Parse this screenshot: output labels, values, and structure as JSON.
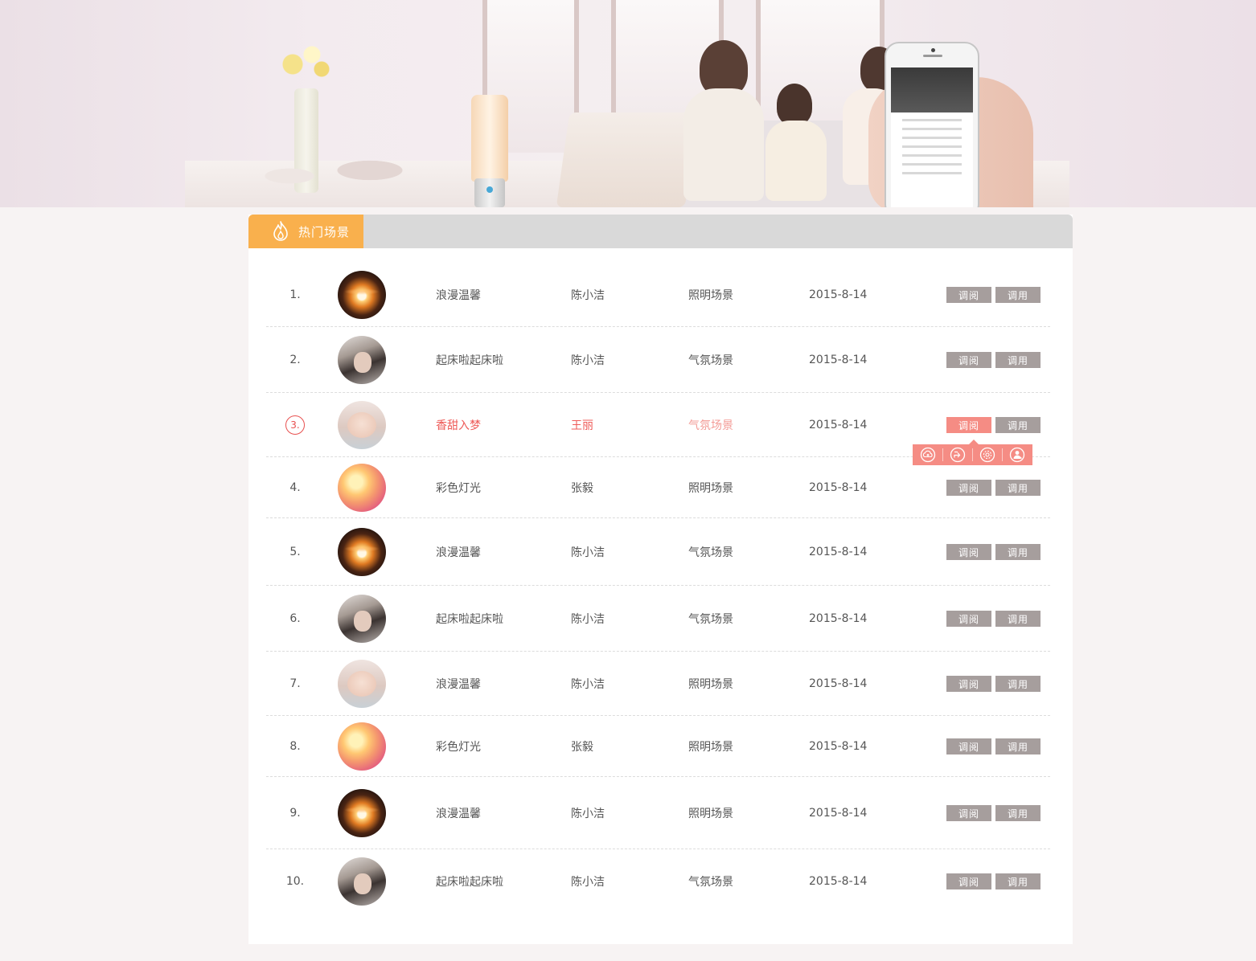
{
  "panel": {
    "title": "热门场景",
    "flame_icon": "flame-icon"
  },
  "colors": {
    "accent_orange": "#f9b04d",
    "highlight_red": "#ee5b58",
    "button_gray": "#a69e9d",
    "button_active": "#f58c84"
  },
  "buttons": {
    "view": "调阅",
    "apply": "调用"
  },
  "popup": {
    "icons": [
      "cloud-upload-icon",
      "share-icon",
      "settings-icon",
      "user-icon"
    ]
  },
  "rows": [
    {
      "num": "1.",
      "avatar": "candle-light",
      "name": "浪漫温馨",
      "owner": "陈小洁",
      "type": "照明场景",
      "date": "2015-8-14"
    },
    {
      "num": "2.",
      "avatar": "girl",
      "name": "起床啦起床啦",
      "owner": "陈小洁",
      "type": "气氛场景",
      "date": "2015-8-14"
    },
    {
      "num": "3.",
      "avatar": "sleeping-baby",
      "name": "香甜入梦",
      "owner": "王丽",
      "type": "气氛场景",
      "date": "2015-8-14",
      "active": true
    },
    {
      "num": "4.",
      "avatar": "colorful-light",
      "name": "彩色灯光",
      "owner": "张毅",
      "type": "照明场景",
      "date": "2015-8-14"
    },
    {
      "num": "5.",
      "avatar": "candle-light",
      "name": "浪漫温馨",
      "owner": "陈小洁",
      "type": "气氛场景",
      "date": "2015-8-14"
    },
    {
      "num": "6.",
      "avatar": "girl",
      "name": "起床啦起床啦",
      "owner": "陈小洁",
      "type": "气氛场景",
      "date": "2015-8-14"
    },
    {
      "num": "7.",
      "avatar": "sleeping-baby",
      "name": "浪漫温馨",
      "owner": "陈小洁",
      "type": "照明场景",
      "date": "2015-8-14"
    },
    {
      "num": "8.",
      "avatar": "colorful-light",
      "name": "彩色灯光",
      "owner": "张毅",
      "type": "照明场景",
      "date": "2015-8-14"
    },
    {
      "num": "9.",
      "avatar": "candle-light",
      "name": "浪漫温馨",
      "owner": "陈小洁",
      "type": "照明场景",
      "date": "2015-8-14"
    },
    {
      "num": "10.",
      "avatar": "girl",
      "name": "起床啦起床啦",
      "owner": "陈小洁",
      "type": "气氛场景",
      "date": "2015-8-14"
    }
  ]
}
